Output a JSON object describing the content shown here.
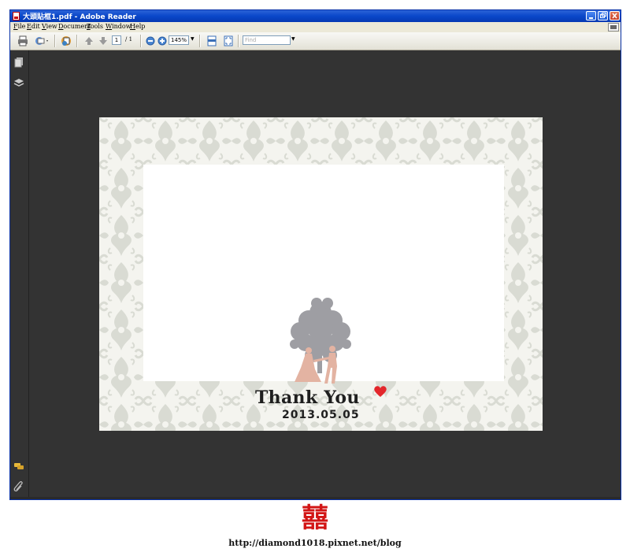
{
  "window": {
    "title": "大頭貼框1.pdf - Adobe Reader"
  },
  "menu": [
    "File",
    "Edit",
    "View",
    "Document",
    "Tools",
    "Window",
    "Help"
  ],
  "toolbar": {
    "page_current": "1",
    "page_total": "/ 1",
    "zoom": "145%",
    "find_placeholder": "Find"
  },
  "document": {
    "thanks_text": "Thank You",
    "date": "2013.05.05"
  },
  "footer": {
    "mark": "囍",
    "url": "http://diamond1018.pixnet.net/blog"
  },
  "colors": {
    "viewer_bg": "#333333",
    "pattern": "#d9dbd3",
    "tree": "#9e9ea3",
    "couple": "#e3b3a2",
    "heart": "#e3262b",
    "footer_mark": "#d21515"
  }
}
